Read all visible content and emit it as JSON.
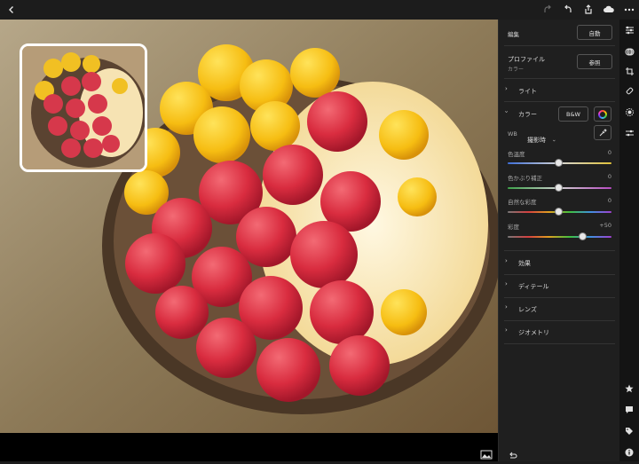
{
  "topbar": {
    "back_icon": "chevron-left-icon",
    "redo_icon": "redo-icon",
    "undo_icon": "undo-icon",
    "share_icon": "share-icon",
    "cloud_icon": "cloud-sync-icon",
    "more_icon": "more-icon"
  },
  "panel": {
    "edit_title": "編集",
    "auto_label": "自動",
    "profile_title": "プロファイル",
    "profile_value": "カラー",
    "browse_label": "参照",
    "light_label": "ライト",
    "color_label": "カラー",
    "bw_label": "B&W",
    "wb_label": "WB",
    "wb_value": "撮影時",
    "sliders": [
      {
        "label": "色温度",
        "value": "0"
      },
      {
        "label": "色かぶり補正",
        "value": "0"
      },
      {
        "label": "自然な彩度",
        "value": "0"
      },
      {
        "label": "彩度",
        "value": "+50"
      }
    ],
    "sections": [
      "効果",
      "ディテール",
      "レンズ",
      "ジオメトリ"
    ]
  },
  "colors": {
    "accent": "#2a7bff",
    "panel_bg": "#1f1f1f"
  }
}
